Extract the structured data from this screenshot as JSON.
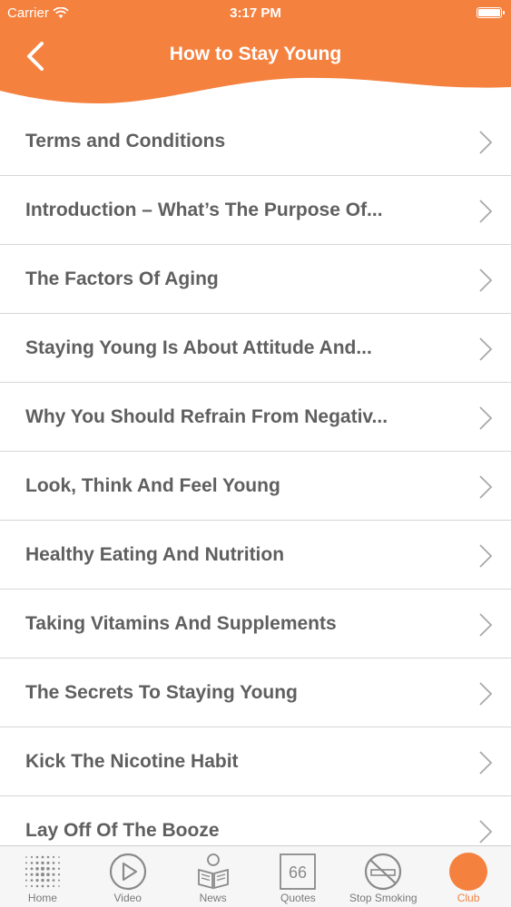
{
  "status_bar": {
    "carrier": "Carrier",
    "time": "3:17 PM",
    "battery_level": 1.0
  },
  "header": {
    "title": "How to Stay Young"
  },
  "list": {
    "items": [
      {
        "label": "Terms and Conditions"
      },
      {
        "label": "Introduction – What’s The Purpose Of..."
      },
      {
        "label": "The Factors Of Aging"
      },
      {
        "label": "Staying Young Is About Attitude And..."
      },
      {
        "label": "Why You Should Refrain From Negativ..."
      },
      {
        "label": "Look, Think And Feel Young"
      },
      {
        "label": "Healthy Eating And Nutrition"
      },
      {
        "label": "Taking Vitamins And Supplements"
      },
      {
        "label": "The Secrets To Staying Young"
      },
      {
        "label": "Kick The Nicotine Habit"
      },
      {
        "label": "Lay Off Of The Booze"
      }
    ]
  },
  "tabbar": {
    "tabs": [
      {
        "label": "Home",
        "icon": "home-dots-icon"
      },
      {
        "label": "Video",
        "icon": "play-icon"
      },
      {
        "label": "News",
        "icon": "news-reader-icon"
      },
      {
        "label": "Quotes",
        "icon": "quote-66-icon",
        "glyph": "66"
      },
      {
        "label": "Stop Smoking",
        "icon": "no-smoking-icon"
      },
      {
        "label": "Club",
        "icon": "club-circle-icon",
        "active": true
      }
    ]
  },
  "colors": {
    "accent": "#f5813f",
    "text": "#5f5f5f",
    "divider": "#d6d6d6",
    "tabbar_bg": "#f6f6f6",
    "inactive_icon": "#8a8a8a"
  }
}
